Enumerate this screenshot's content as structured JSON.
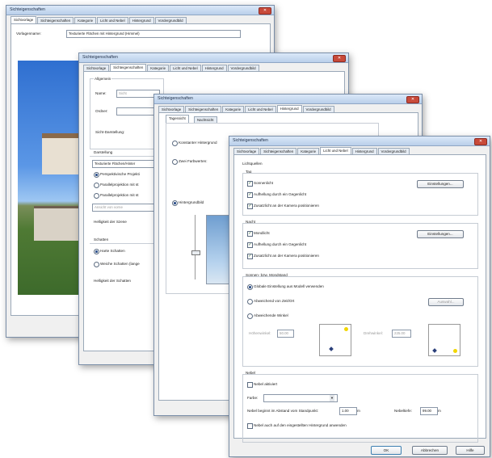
{
  "w1": {
    "title": "Sichteigenschaften",
    "tabs": [
      "Sichtvorlage",
      "Sichteigenschaften",
      "Kategorie",
      "Licht und Nebel",
      "Hintergrund",
      "Vordergrundbild"
    ],
    "template_label": "Vorlagenname:",
    "template_value": "Texturierte Flächen mit Hintergrund (Himmel)"
  },
  "w2": {
    "title": "Sichteigenschaften",
    "tabs": [
      "Sichtvorlage",
      "Sichteigenschaften",
      "Kategorie",
      "Licht und Nebel",
      "Hintergrund",
      "Vordergrundbild"
    ],
    "general": "Allgemein",
    "name_label": "Name:",
    "name_value": "Sicht",
    "folder_label": "Ordner:",
    "display_label": "Sicht-Darstellung:",
    "presentation": "Darstellung",
    "dropdown_value": "Texturierte Flächen/Hinter",
    "radio1": "Perspektivische Projekti",
    "radio2": "Parallelprojektion mit st",
    "radio3": "Parallelprojektion mit st",
    "view_from": "Ansicht von vorne",
    "brightness_scene": "Helligkeit der Szene",
    "shadows": "Schatten",
    "hard_shadows": "Harte Schatten",
    "soft_shadows": "Weiche Schatten (lange",
    "shadow_brightness": "Helligkeit der Schatten"
  },
  "w3": {
    "title": "Sichteigenschaften",
    "tabs": [
      "Sichtvorlage",
      "Sichteigenschaften",
      "Kategorie",
      "Licht und Nebel",
      "Hintergrund",
      "Vordergrundbild"
    ],
    "subtabs": [
      "Tagessicht",
      "Nachtsicht"
    ],
    "const_bg": "Konstanter Hintergrund",
    "two_colors": "Zwei Farbwerten:",
    "bg_image": "Hintergrundbild"
  },
  "w4": {
    "title": "Sichteigenschaften",
    "tabs": [
      "Sichtvorlage",
      "Sichteigenschaften",
      "Kategorie",
      "Licht und Nebel",
      "Hintergrund",
      "Vordergrundbild"
    ],
    "light_sources": "Lichtquellen",
    "day": "Tag",
    "sunlight": "Sonnenlicht",
    "brightening_day": "Aufhellung durch ein Gegenlicht",
    "extra_light_day": "Zusatzlicht an der Kamera positionieren",
    "settings_day": "Einstellungen...",
    "night": "Nacht",
    "moonlight": "Mondlicht",
    "brightening_night": "Aufhellung durch ein Gegenlicht",
    "extra_light_night": "Zusatzlicht an der Kamera positionieren",
    "settings_night": "Einstellungen...",
    "sun_moon": "Sonnen- bzw. Mondstand",
    "global_setting": "Globale Einstellung aus Modell verwenden",
    "deviating_date": "Abweichend von Zeit/Ort",
    "deviating_angle": "Abweichende Winkel",
    "select_btn": "Auswahl...",
    "height_angle_label": "Höhenwinkel:",
    "height_angle_value": "50.00",
    "rotation_angle_label": "Drehwinkel:",
    "rotation_angle_value": "225.00",
    "fog": "Nebel",
    "fog_active": "Nebel aktiviert",
    "color_label": "Farbe:",
    "fog_start_label": "Nebel beginnt im Abstand vom Standpunkt:",
    "fog_start_value": "1.00",
    "fog_depth_label": "Nebeltiefe:",
    "fog_depth_value": "99.00",
    "fog_bg": "Nebel auch auf den eingestellten Hintergrund anwenden",
    "ok": "OK",
    "cancel": "Abbrechen",
    "help": "Hilfe"
  }
}
